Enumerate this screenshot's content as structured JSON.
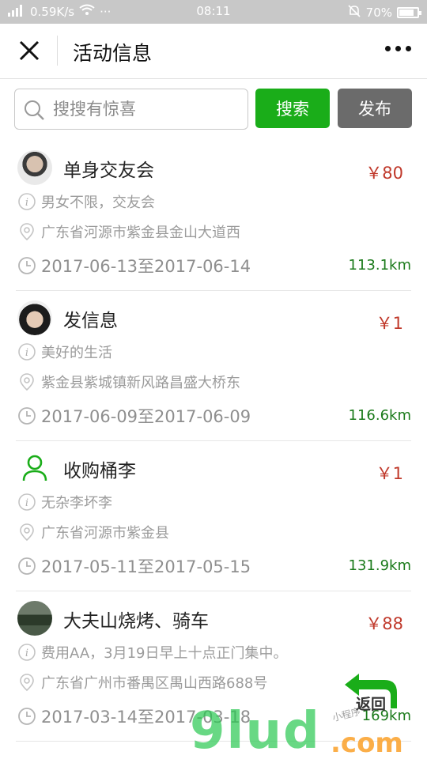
{
  "status_bar": {
    "signal": "4G",
    "speed": "0.59K/s",
    "more": "···",
    "time": "08:11",
    "battery": "70%"
  },
  "nav": {
    "title": "活动信息"
  },
  "search": {
    "placeholder": "搜搜有惊喜",
    "search_label": "搜索",
    "publish_label": "发布"
  },
  "colors": {
    "accent_green": "#1aad19",
    "price_red": "#c0392b",
    "distance_green": "#1a7a1a"
  },
  "items": [
    {
      "title": "单身交友会",
      "price": "￥80",
      "desc": "男女不限，交友会",
      "address": "广东省河源市紫金县金山大道西",
      "date": "2017-06-13至2017-06-14",
      "distance": "113.1km",
      "avatar": "photo"
    },
    {
      "title": "发信息",
      "price": "￥1",
      "desc": "美好的生活",
      "address": "紫金县紫城镇新风路昌盛大桥东",
      "date": "2017-06-09至2017-06-09",
      "distance": "116.6km",
      "avatar": "photo"
    },
    {
      "title": "收购桶李",
      "price": "￥1",
      "desc": "无杂李坏李",
      "address": "广东省河源市紫金县",
      "date": "2017-05-11至2017-05-15",
      "distance": "131.9km",
      "avatar": "default-user-icon"
    },
    {
      "title": "大夫山烧烤、骑车",
      "price": "￥88",
      "desc": "费用AA，3月19日早上十点正门集中。",
      "address": "广东省广州市番禺区禺山西路688号",
      "date": "2017-03-14至2017-03-18",
      "distance": "169km",
      "avatar": "photo"
    }
  ],
  "back_button": {
    "label": "返回"
  },
  "watermark": {
    "main": "9lud",
    "suffix": ".com",
    "small": "小程序"
  }
}
